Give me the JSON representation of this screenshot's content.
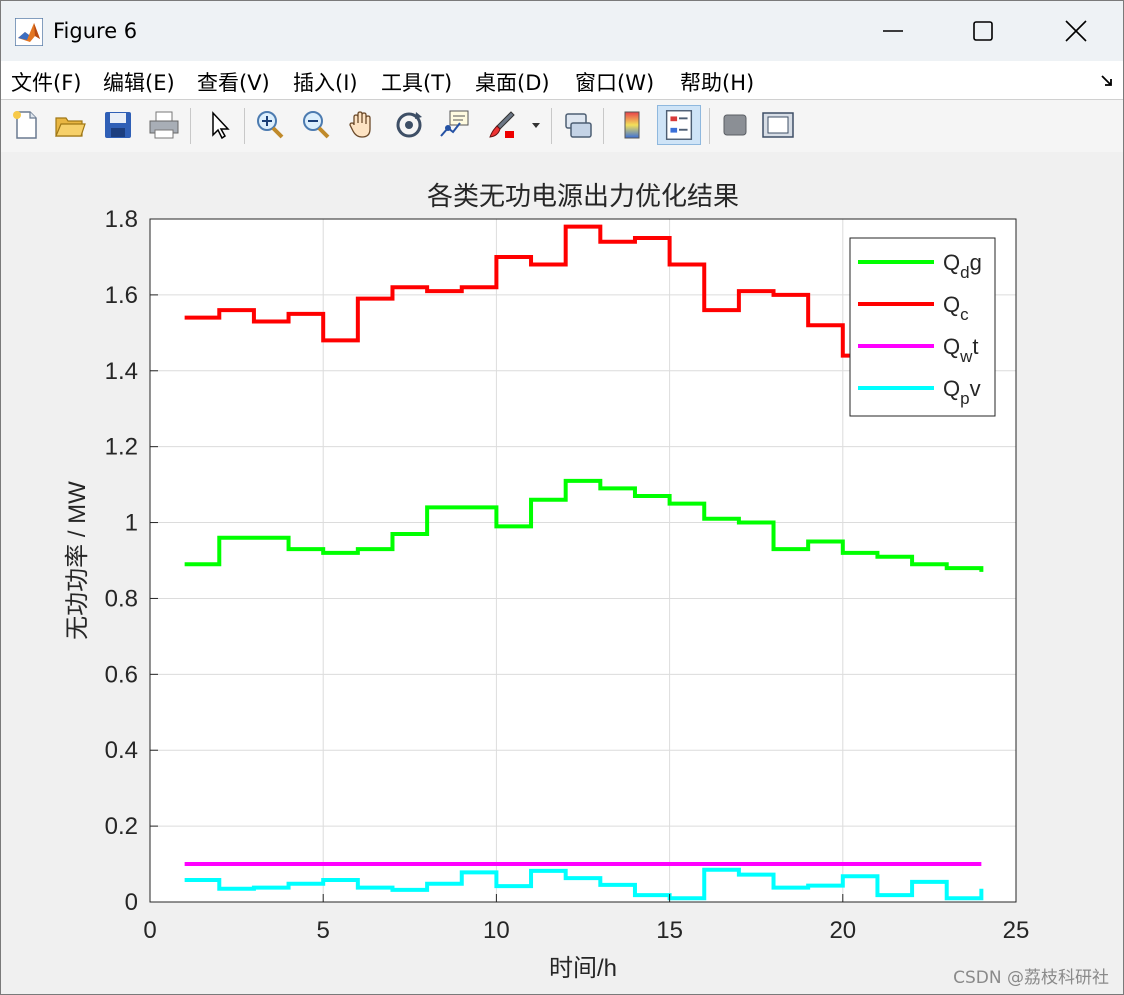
{
  "window": {
    "title": "Figure 6"
  },
  "menu": {
    "items": [
      {
        "label": "文件(F)"
      },
      {
        "label": "编辑(E)"
      },
      {
        "label": "查看(V)"
      },
      {
        "label": "插入(I)"
      },
      {
        "label": "工具(T)"
      },
      {
        "label": "桌面(D)"
      },
      {
        "label": "窗口(W)"
      },
      {
        "label": "帮助(H)"
      }
    ]
  },
  "toolbar": {
    "buttons": [
      {
        "icon": "new-figure-icon"
      },
      {
        "icon": "open-file-icon"
      },
      {
        "icon": "save-icon"
      },
      {
        "icon": "print-icon"
      },
      {
        "icon": "edit-plot-arrow-icon"
      },
      {
        "icon": "zoom-in-icon"
      },
      {
        "icon": "zoom-out-icon"
      },
      {
        "icon": "pan-hand-icon"
      },
      {
        "icon": "rotate-3d-icon"
      },
      {
        "icon": "data-cursor-icon"
      },
      {
        "icon": "brush-icon"
      },
      {
        "icon": "link-plot-icon"
      },
      {
        "icon": "colorbar-icon"
      },
      {
        "icon": "legend-icon"
      },
      {
        "icon": "hide-plot-tools-icon"
      },
      {
        "icon": "show-plot-tools-icon"
      }
    ],
    "active": "legend-icon"
  },
  "colors": {
    "qdg": "#00ff00",
    "qc": "#ff0000",
    "qwt": "#ff00ff",
    "qpv": "#00ffff"
  },
  "watermark": "CSDN @荔枝科研社",
  "chart_data": {
    "type": "line",
    "step": true,
    "title": "各类无功电源出力优化结果",
    "xlabel": "时间/h",
    "ylabel": "无功功率 / MW",
    "xlim": [
      0,
      25
    ],
    "ylim": [
      0,
      1.8
    ],
    "xticks": [
      "0",
      "5",
      "10",
      "15",
      "20",
      "25"
    ],
    "yticks": [
      "0",
      "0.2",
      "0.4",
      "0.6",
      "0.8",
      "1",
      "1.2",
      "1.4",
      "1.6",
      "1.8"
    ],
    "grid": true,
    "legend_position": "top-right",
    "x": [
      1,
      2,
      3,
      4,
      5,
      6,
      7,
      8,
      9,
      10,
      11,
      12,
      13,
      14,
      15,
      16,
      17,
      18,
      19,
      20,
      21,
      22,
      23,
      24
    ],
    "series": [
      {
        "name": "Q_dg",
        "legend": {
          "main": "Q",
          "sub": "d",
          "tail": "g"
        },
        "color": "#00ff00",
        "values": [
          0.89,
          0.96,
          0.96,
          0.93,
          0.92,
          0.93,
          0.97,
          1.04,
          1.04,
          0.99,
          1.06,
          1.11,
          1.09,
          1.07,
          1.05,
          1.01,
          1.0,
          0.93,
          0.95,
          0.92,
          0.91,
          0.89,
          0.88,
          0.87
        ]
      },
      {
        "name": "Q_c",
        "legend": {
          "main": "Q",
          "sub": "c",
          "tail": ""
        },
        "color": "#ff0000",
        "values": [
          1.54,
          1.56,
          1.53,
          1.55,
          1.48,
          1.59,
          1.62,
          1.61,
          1.62,
          1.7,
          1.68,
          1.78,
          1.74,
          1.75,
          1.68,
          1.56,
          1.61,
          1.6,
          1.52,
          1.44,
          1.47,
          1.45,
          1.46,
          1.47
        ]
      },
      {
        "name": "Q_wt",
        "legend": {
          "main": "Q",
          "sub": "w",
          "tail": "t"
        },
        "color": "#ff00ff",
        "values": [
          0.1,
          0.1,
          0.1,
          0.1,
          0.1,
          0.1,
          0.1,
          0.1,
          0.1,
          0.1,
          0.1,
          0.1,
          0.1,
          0.1,
          0.1,
          0.1,
          0.1,
          0.1,
          0.1,
          0.1,
          0.1,
          0.1,
          0.1,
          0.1
        ]
      },
      {
        "name": "Q_pv",
        "legend": {
          "main": "Q",
          "sub": "p",
          "tail": "v"
        },
        "color": "#00ffff",
        "values": [
          0.058,
          0.035,
          0.038,
          0.048,
          0.058,
          0.038,
          0.032,
          0.048,
          0.078,
          0.042,
          0.082,
          0.063,
          0.045,
          0.018,
          0.01,
          0.085,
          0.072,
          0.038,
          0.043,
          0.068,
          0.018,
          0.053,
          0.01,
          0.035
        ]
      }
    ]
  }
}
